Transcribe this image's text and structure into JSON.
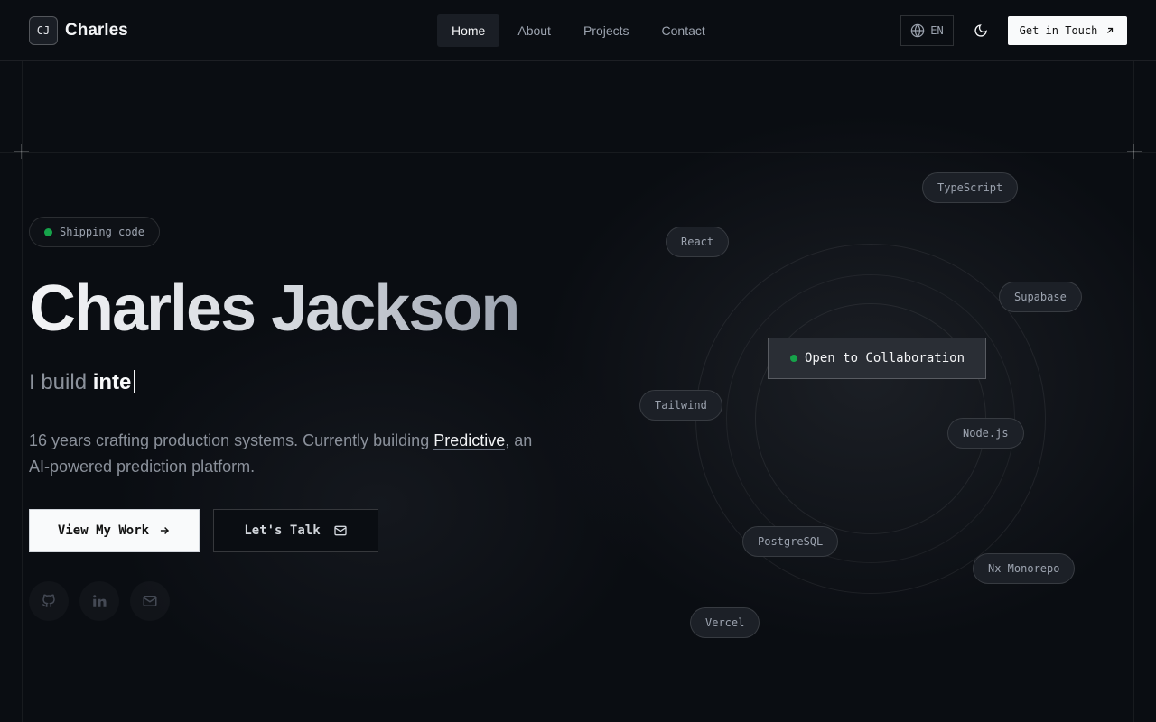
{
  "header": {
    "logo_text": "CJ",
    "brand": "Charles",
    "nav": [
      {
        "label": "Home",
        "active": true
      },
      {
        "label": "About",
        "active": false
      },
      {
        "label": "Projects",
        "active": false
      },
      {
        "label": "Contact",
        "active": false
      }
    ],
    "language": "EN",
    "cta": "Get in Touch"
  },
  "hero": {
    "status": "Shipping code",
    "name": "Charles Jackson",
    "tagline_prefix": "I build",
    "tagline_typed": "inte",
    "desc_before": "16 years crafting production systems. Currently building ",
    "desc_highlight": "Predictive",
    "desc_after": ", an AI-powered prediction platform.",
    "primary_button": "View My Work",
    "secondary_button": "Let's Talk"
  },
  "orbit": {
    "center_label": "Open to Collaboration",
    "techs": [
      "TypeScript",
      "React",
      "Supabase",
      "Tailwind",
      "Node.js",
      "PostgreSQL",
      "Nx Monorepo",
      "Vercel"
    ]
  },
  "colors": {
    "accent_green": "#16a34a",
    "background": "#0a0d12"
  },
  "icons": [
    "globe-icon",
    "moon-icon",
    "arrow-up-right-icon",
    "arrow-right-icon",
    "mail-icon",
    "github-icon",
    "linkedin-icon",
    "email-icon"
  ]
}
